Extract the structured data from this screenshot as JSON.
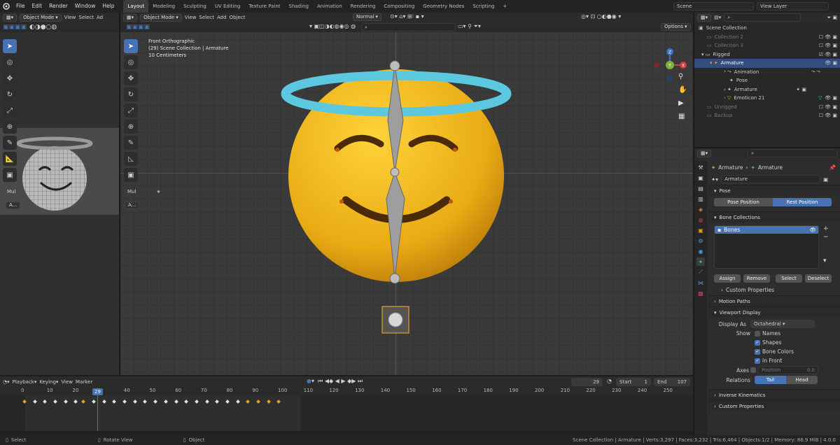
{
  "topbar": {
    "menus": [
      "File",
      "Edit",
      "Render",
      "Window",
      "Help"
    ],
    "workspaces": [
      "Layout",
      "Modeling",
      "Sculpting",
      "UV Editing",
      "Texture Paint",
      "Shading",
      "Animation",
      "Rendering",
      "Compositing",
      "Geometry Nodes",
      "Scripting"
    ],
    "add_tab": "+",
    "scene": "Scene",
    "view_layer": "View Layer"
  },
  "left_viewport": {
    "mode": "Object Mode",
    "menus": [
      "View",
      "Select",
      "Ad"
    ],
    "panel_label": "Mul",
    "panel_button": "A..."
  },
  "main_viewport": {
    "mode": "Object Mode",
    "menus": [
      "View",
      "Select",
      "Add",
      "Object"
    ],
    "orientation": "Normal",
    "options": "Options",
    "overlay_lines": [
      "Front Orthographic",
      "(29) Scene Collection | Armature",
      "10 Centimeters"
    ],
    "panel_label": "Mul",
    "panel_button": "A...",
    "gizmo": {
      "z": "Z",
      "x": "X",
      "y": "Y"
    }
  },
  "outliner": {
    "rows": [
      {
        "label": "Scene Collection",
        "indent": 0,
        "state": "normal"
      },
      {
        "label": "Collection 2",
        "indent": 1,
        "state": "dim"
      },
      {
        "label": "Collection 3",
        "indent": 1,
        "state": "dim"
      },
      {
        "label": "Rigged",
        "indent": 1,
        "state": "normal"
      },
      {
        "label": "Armature",
        "indent": 2,
        "state": "selected"
      },
      {
        "label": "Animation",
        "indent": 3,
        "state": "normal"
      },
      {
        "label": "Pose",
        "indent": 3,
        "state": "normal"
      },
      {
        "label": "Armature",
        "indent": 3,
        "state": "normal"
      },
      {
        "label": "Emoticon 21",
        "indent": 3,
        "state": "normal"
      },
      {
        "label": "Unrigged",
        "indent": 1,
        "state": "dim"
      },
      {
        "label": "Backup",
        "indent": 1,
        "state": "dim"
      }
    ]
  },
  "properties": {
    "breadcrumb": [
      "Armature",
      "Armature"
    ],
    "data_name": "Armature",
    "pose": {
      "title": "Pose",
      "pose_position": "Pose Position",
      "rest_position": "Rest Position"
    },
    "bone_collections": {
      "title": "Bone Collections",
      "item": "Bones",
      "assign": "Assign",
      "remove": "Remove",
      "select": "Select",
      "deselect": "Deselect",
      "custom_properties": "Custom Properties"
    },
    "motion_paths": "Motion Paths",
    "viewport_display": {
      "title": "Viewport Display",
      "display_as_label": "Display As",
      "display_as_value": "Octahedral",
      "show_label": "Show",
      "names": "Names",
      "shapes": "Shapes",
      "bone_colors": "Bone Colors",
      "in_front": "In Front",
      "axes_label": "Axes",
      "position_label": "Position",
      "position_value": "0.0",
      "relations_label": "Relations",
      "tail": "Tail",
      "head": "Head"
    },
    "inverse_kinematics": "Inverse Kinematics",
    "custom_properties": "Custom Properties"
  },
  "timeline": {
    "menus": [
      "Playback",
      "Keying",
      "View",
      "Marker"
    ],
    "current_frame": "29",
    "start_label": "Start",
    "start_value": "1",
    "end_label": "End",
    "end_value": "107",
    "ticks": [
      "0",
      "10",
      "20",
      "29",
      "40",
      "50",
      "60",
      "70",
      "80",
      "90",
      "100",
      "110",
      "120",
      "130",
      "140",
      "150",
      "160",
      "170",
      "180",
      "190",
      "200",
      "210",
      "220",
      "230",
      "240",
      "250"
    ]
  },
  "statusbar": {
    "select": "Select",
    "rotate": "Rotate View",
    "object": "Object",
    "stats": "Scene Collection | Armature | Verts:3,297 | Faces:3,232 | Tris:6,464 | Objects:1/2 | Memory: 86.9 MiB | 4.0.0"
  },
  "colors": {
    "accent": "#4772b3",
    "selected_row": "#334d80",
    "keyframe_selected": "#e8a020",
    "halo": "#5cc8e0",
    "face": "#e8b41a"
  }
}
